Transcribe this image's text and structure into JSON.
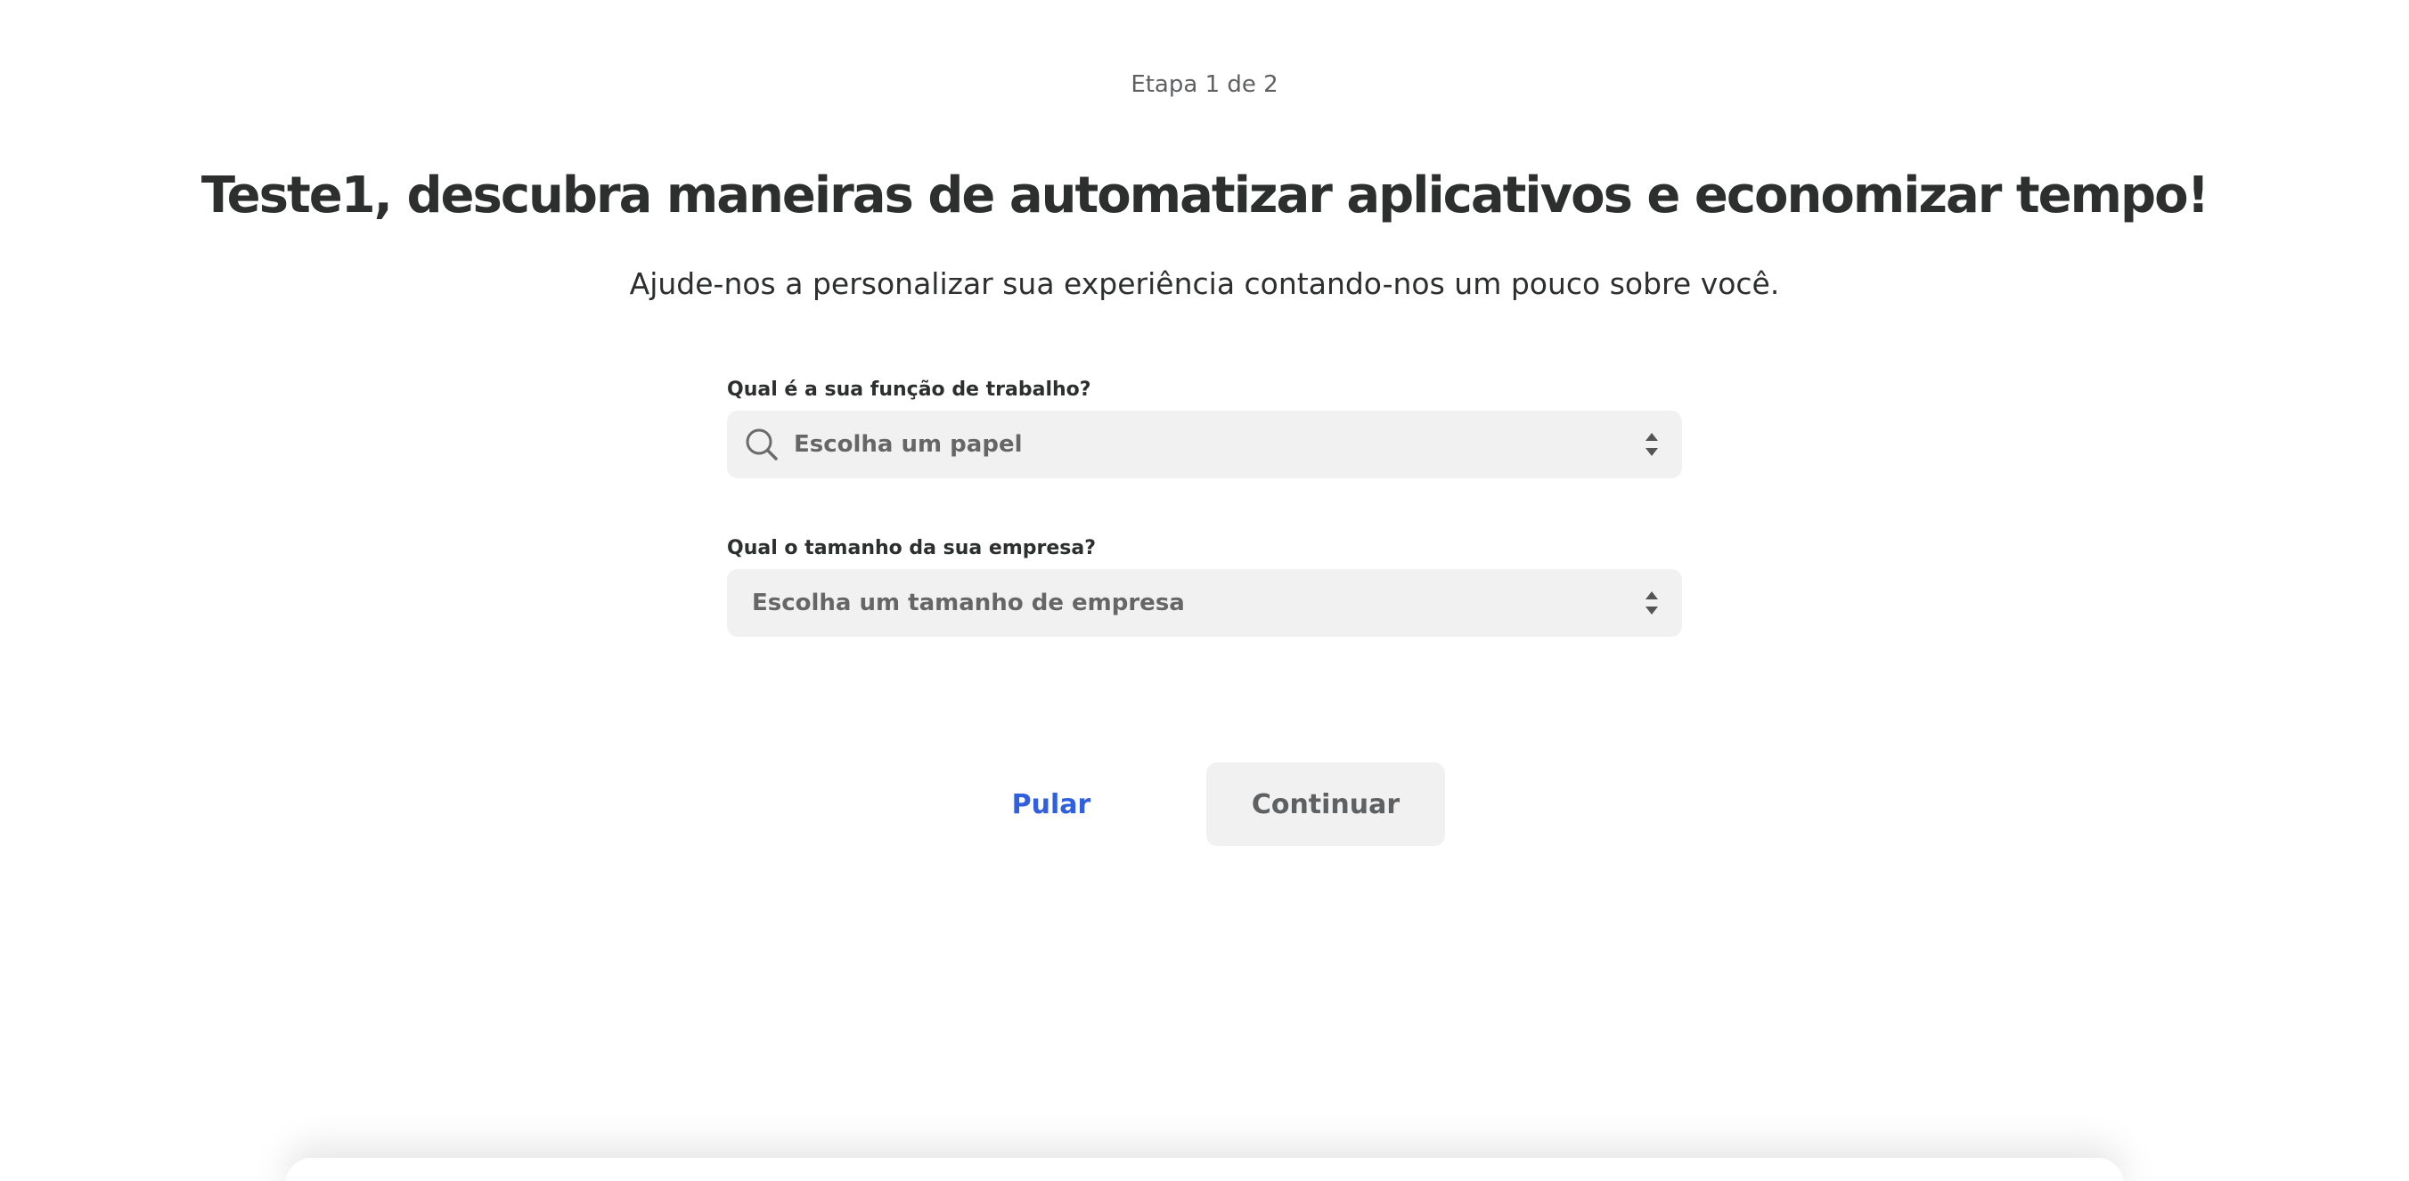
{
  "step_indicator": "Etapa 1 de 2",
  "title": "Teste1, descubra maneiras de automatizar aplicativos e economizar tempo!",
  "subtitle": "Ajude-nos a personalizar sua experiência contando-nos um pouco sobre você.",
  "fields": {
    "role": {
      "label": "Qual é a sua função de trabalho?",
      "placeholder": "Escolha um papel",
      "icon": "search-icon"
    },
    "company_size": {
      "label": "Qual o tamanho da sua empresa?",
      "placeholder": "Escolha um tamanho de empresa"
    }
  },
  "actions": {
    "skip_label": "Pular",
    "continue_label": "Continuar"
  },
  "colors": {
    "link": "#3060e0",
    "field_bg": "#f1f1f1",
    "text": "#2d2e2e",
    "muted": "#5f6062"
  }
}
